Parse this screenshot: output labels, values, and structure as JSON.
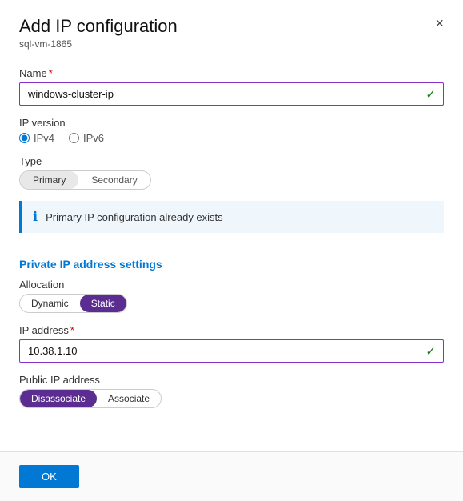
{
  "dialog": {
    "title": "Add IP configuration",
    "subtitle": "sql-vm-1865",
    "close_label": "×"
  },
  "form": {
    "name_label": "Name",
    "name_value": "windows-cluster-ip",
    "name_placeholder": "windows-cluster-ip",
    "ip_version_label": "IP version",
    "ip_version_options": [
      "IPv4",
      "IPv6"
    ],
    "ip_version_selected": "IPv4",
    "type_label": "Type",
    "type_options": [
      "Primary",
      "Secondary"
    ],
    "type_selected": "Primary",
    "info_message": "Primary IP configuration already exists",
    "private_ip_section": "Private IP address settings",
    "allocation_label": "Allocation",
    "allocation_options": [
      "Dynamic",
      "Static"
    ],
    "allocation_selected": "Static",
    "ip_address_label": "IP address",
    "ip_address_value": "10.38.1.10",
    "ip_address_placeholder": "10.38.1.10",
    "public_ip_label": "Public IP address",
    "public_ip_options": [
      "Disassociate",
      "Associate"
    ],
    "public_ip_selected": "Disassociate"
  },
  "footer": {
    "ok_label": "OK"
  }
}
